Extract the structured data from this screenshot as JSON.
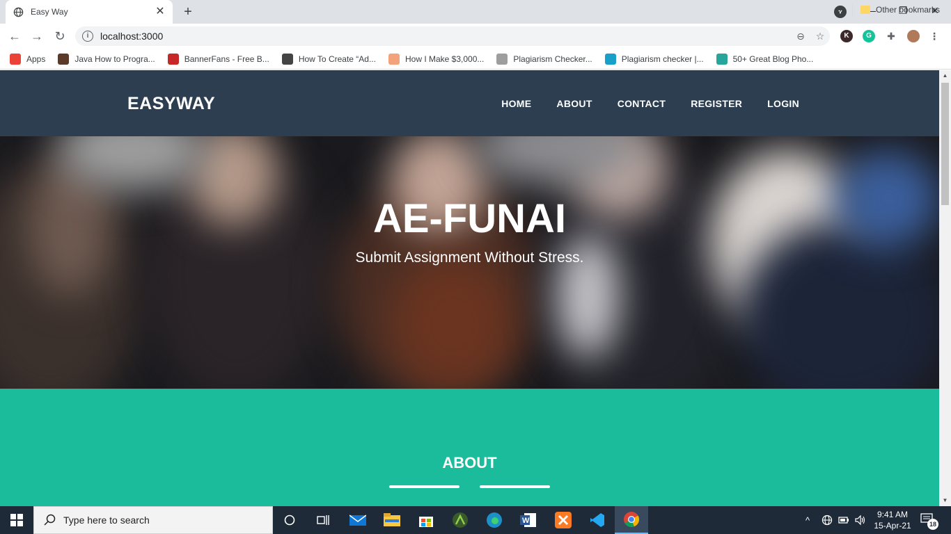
{
  "browser": {
    "tab_title": "Easy Way",
    "url": "localhost:3000",
    "bookmarks": [
      {
        "label": "Apps",
        "icon": "apps-grid-icon",
        "color": "#ea4335"
      },
      {
        "label": "Java How to Progra...",
        "icon": "java-icon",
        "color": "#5b3a29"
      },
      {
        "label": "BannerFans - Free B...",
        "icon": "bannerfans-icon",
        "color": "#c62828"
      },
      {
        "label": "How To Create “Ad...",
        "icon": "site-icon",
        "color": "#444444"
      },
      {
        "label": "How I Make $3,000...",
        "icon": "site-icon",
        "color": "#f4a27a"
      },
      {
        "label": "Plagiarism Checker...",
        "icon": "sst-icon",
        "color": "#9e9e9e"
      },
      {
        "label": "Plagiarism checker |...",
        "icon": "checker-icon",
        "color": "#18a0c9"
      },
      {
        "label": "50+ Great Blog Pho...",
        "icon": "d-icon",
        "color": "#26a69a"
      }
    ],
    "bookmarks_more": "»",
    "other_bookmarks": "Other bookmarks"
  },
  "site": {
    "brand": "EASYWAY",
    "nav": [
      "HOME",
      "ABOUT",
      "CONTACT",
      "REGISTER",
      "LOGIN"
    ],
    "hero": {
      "title": "AE-FUNAI",
      "subtitle": "Submit Assignment Without Stress."
    },
    "about": {
      "title": "ABOUT"
    },
    "colors": {
      "navbar": "#2c3e50",
      "accent": "#1abc9c"
    }
  },
  "taskbar": {
    "search_placeholder": "Type here to search",
    "time": "9:41 AM",
    "date": "15-Apr-21",
    "notification_count": "18"
  }
}
